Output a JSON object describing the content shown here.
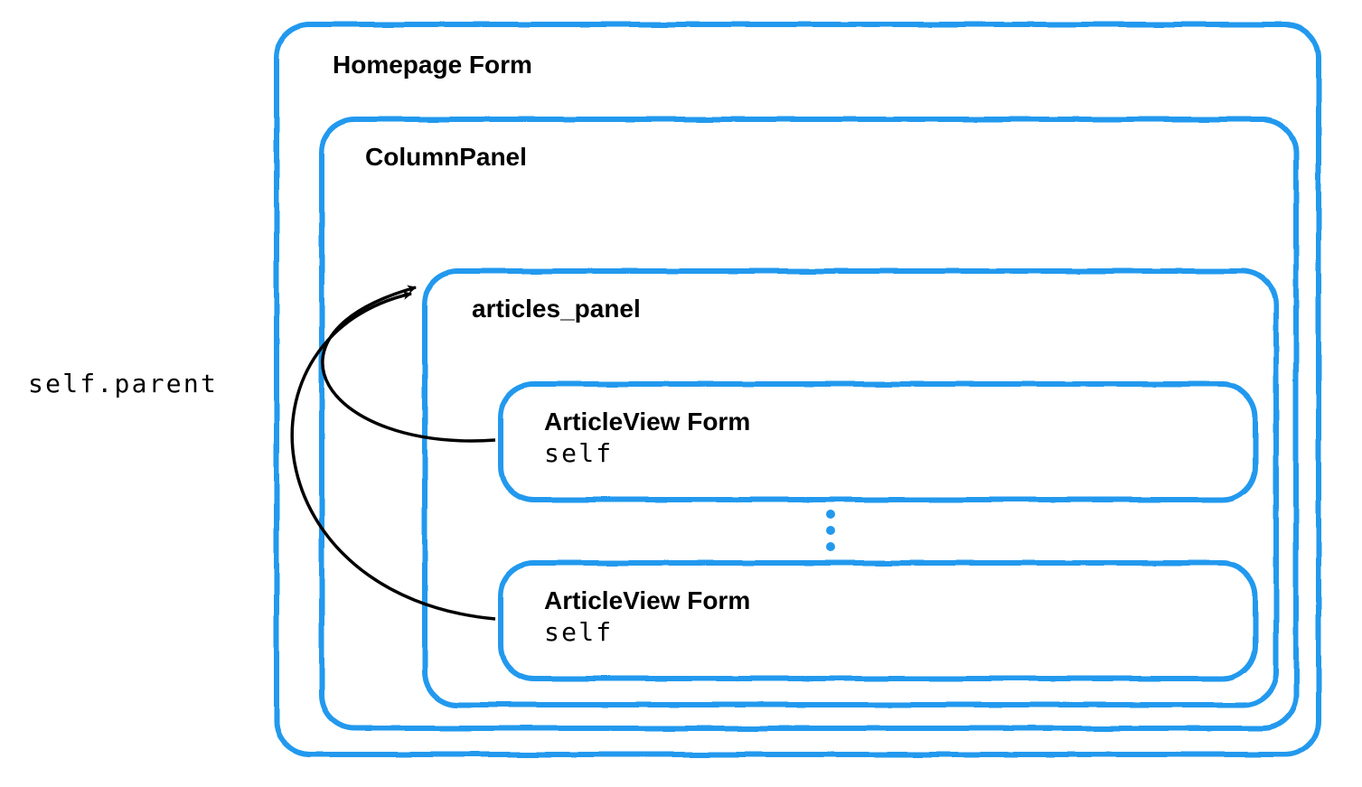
{
  "diagram": {
    "outer_label": "Homepage Form",
    "column_panel_label": "ColumnPanel",
    "articles_panel_label": "articles_panel",
    "article_view_1_title": "ArticleView Form",
    "article_view_1_self": "self",
    "article_view_2_title": "ArticleView Form",
    "article_view_2_self": "self",
    "parent_ref": "self.parent"
  }
}
